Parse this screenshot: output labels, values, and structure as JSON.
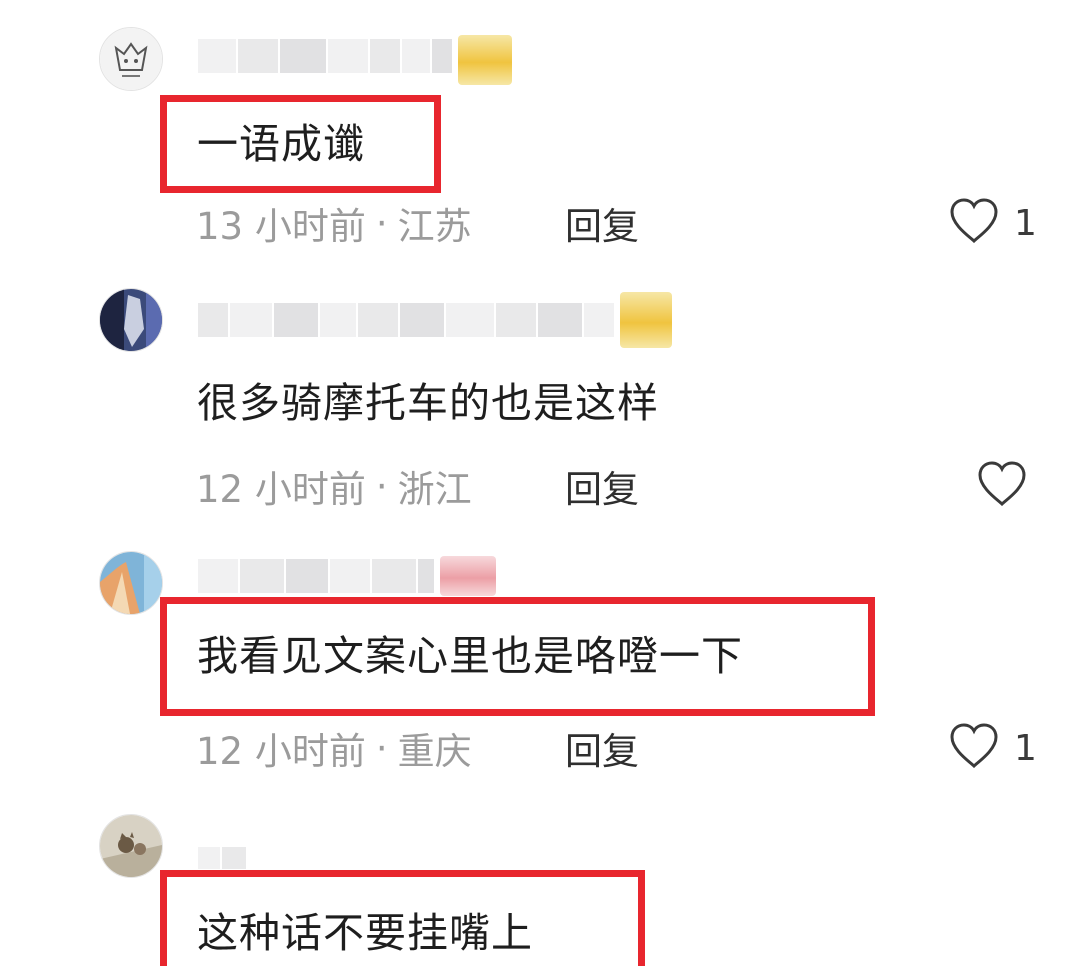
{
  "comments": [
    {
      "text": "一语成谶",
      "time": "13 小时前",
      "location": "江苏",
      "reply_label": "回复",
      "like_count": "1",
      "highlighted": true
    },
    {
      "text": "很多骑摩托车的也是这样",
      "time": "12 小时前",
      "location": "浙江",
      "reply_label": "回复",
      "like_count": "",
      "highlighted": false
    },
    {
      "text": "我看见文案心里也是咯噔一下",
      "time": "12 小时前",
      "location": "重庆",
      "reply_label": "回复",
      "like_count": "1",
      "highlighted": true
    },
    {
      "text": "这种话不要挂嘴上",
      "highlighted": true
    }
  ],
  "meta_separator": "·",
  "colors": {
    "highlight_border": "#e8262e",
    "meta_text": "#9b9b9b",
    "comment_text": "#1e1e1e"
  },
  "icons": {
    "like": "heart-outline-icon"
  }
}
